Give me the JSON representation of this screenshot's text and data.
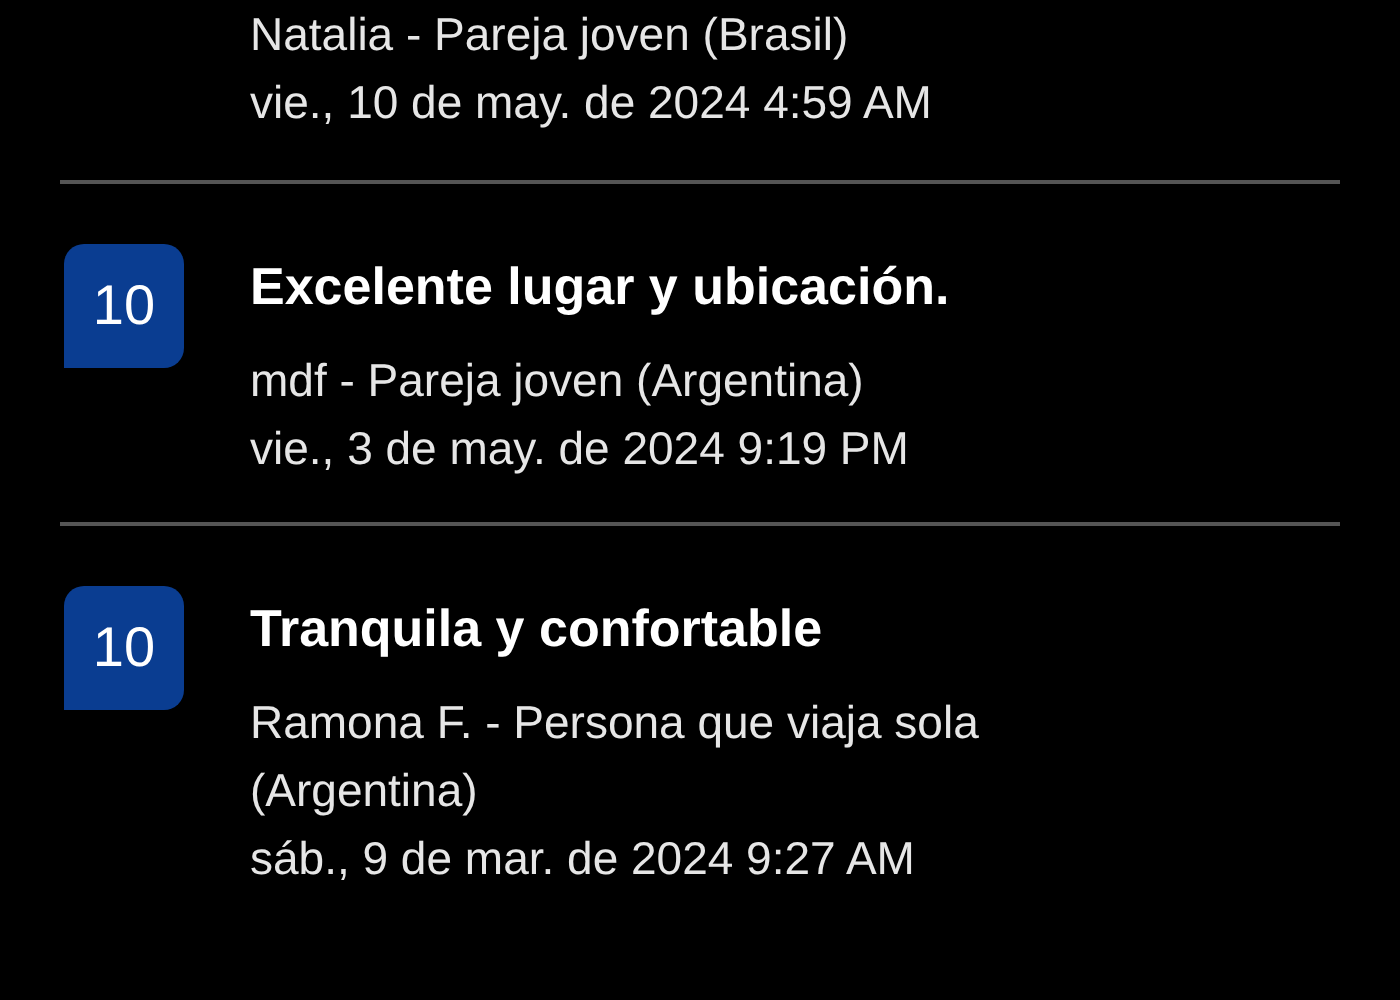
{
  "reviews": [
    {
      "reviewer": "Natalia - Pareja joven (Brasil)",
      "date": "vie., 10 de may. de 2024 4:59 AM"
    },
    {
      "score": "10",
      "title": "Excelente lugar y ubicación.",
      "reviewer": "mdf - Pareja joven (Argentina)",
      "date": "vie., 3 de may. de 2024 9:19 PM"
    },
    {
      "score": "10",
      "title": "Tranquila y confortable",
      "reviewer": "Ramona F. - Persona que viaja sola (Argentina)",
      "date": "sáb., 9 de mar. de 2024 9:27 AM"
    }
  ]
}
